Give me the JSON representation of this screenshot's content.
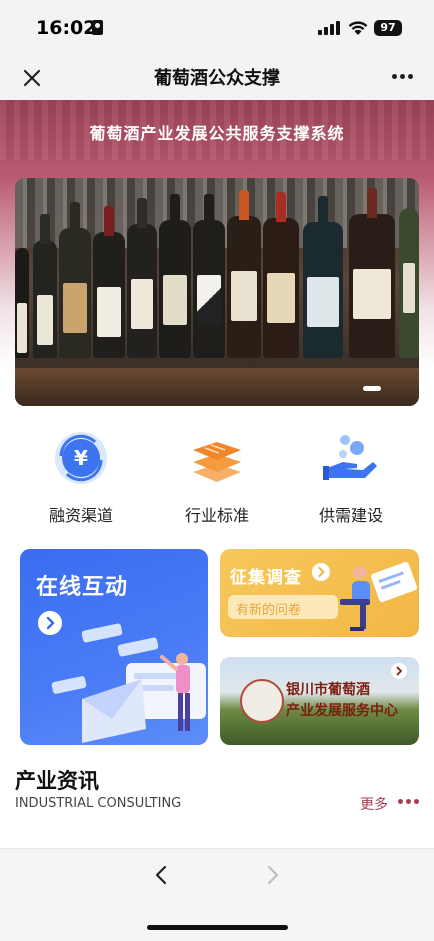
{
  "status_bar": {
    "time": "16:02",
    "battery": "97"
  },
  "nav": {
    "title": "葡萄酒公众支撑"
  },
  "hero": {
    "title": "葡萄酒产业发展公共服务支撑系统"
  },
  "features": [
    {
      "label": "融资渠道",
      "icon": "yuan-exchange-icon"
    },
    {
      "label": "行业标准",
      "icon": "stacked-layers-icon"
    },
    {
      "label": "供需建设",
      "icon": "hand-bubbles-icon"
    }
  ],
  "cards": {
    "online": {
      "title": "在线互动"
    },
    "survey": {
      "title": "征集调查",
      "subtitle": "有新的问卷"
    },
    "center": {
      "line1": "银川市葡萄酒",
      "line2": "产业发展服务中心"
    }
  },
  "news": {
    "title": "产业资讯",
    "subtitle": "INDUSTRIAL CONSULTING",
    "more": "更多"
  },
  "colors": {
    "accent": "#a63d54",
    "hero": "#9b4256",
    "online_card": "#3a6cf0",
    "survey_card": "#f6c85c"
  }
}
